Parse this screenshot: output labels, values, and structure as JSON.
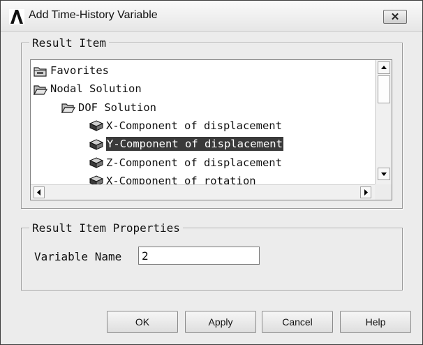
{
  "window": {
    "title": "Add Time-History Variable",
    "close_label": "✕",
    "app_icon": "ansys-logo-icon"
  },
  "result_item": {
    "group_label": "Result Item",
    "tree": [
      {
        "label": "Favorites",
        "icon": "folder-icon",
        "level": 0,
        "selected": false
      },
      {
        "label": "Nodal Solution",
        "icon": "open-folder-icon",
        "level": 0,
        "selected": false
      },
      {
        "label": "DOF Solution",
        "icon": "open-folder-icon",
        "level": 1,
        "selected": false
      },
      {
        "label": "X-Component of displacement",
        "icon": "cube-icon",
        "level": 2,
        "selected": false
      },
      {
        "label": "Y-Component of displacement",
        "icon": "cube-icon",
        "level": 2,
        "selected": true
      },
      {
        "label": "Z-Component of displacement",
        "icon": "cube-icon",
        "level": 2,
        "selected": false
      },
      {
        "label": "X-Component of rotation",
        "icon": "cube-icon",
        "level": 2,
        "selected": false
      }
    ]
  },
  "properties": {
    "group_label": "Result Item Properties",
    "variable_name_label": "Variable Name",
    "variable_name_value": "2"
  },
  "buttons": {
    "ok": "OK",
    "apply": "Apply",
    "cancel": "Cancel",
    "help": "Help"
  },
  "colors": {
    "selection_bg": "#3a3a3a",
    "selection_fg": "#ffffff",
    "dialog_bg": "#ececec"
  }
}
